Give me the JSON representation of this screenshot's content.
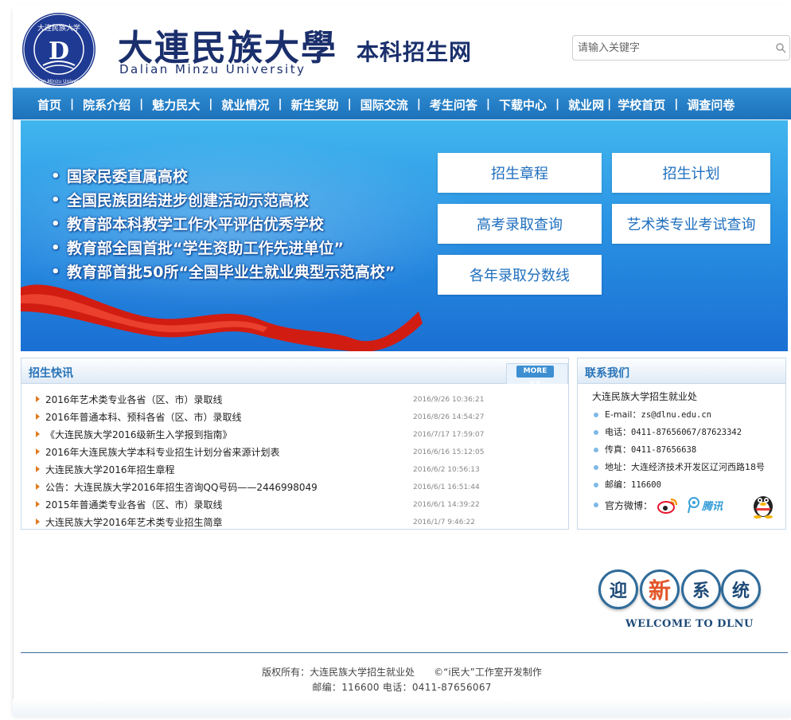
{
  "header": {
    "seal_text": "大连民族大学",
    "seal_text_en": "Dalian Minzu University",
    "university_cn": "大連民族大學",
    "university_en": "Dalian Minzu University",
    "site_title": "本科招生网",
    "search": {
      "placeholder": "请输入关键字",
      "icon": "search-icon"
    }
  },
  "nav": {
    "items": [
      "首页",
      "院系介绍",
      "魅力民大",
      "就业情况",
      "新生奖助",
      "国际交流",
      "考生问答",
      "下载中心",
      "就业网",
      "学校首页",
      "调查问卷"
    ],
    "separator": "|"
  },
  "banner": {
    "bullets": [
      "国家民委直属高校",
      "全国民族团结进步创建活动示范高校",
      "教育部本科教学工作水平评估优秀学校",
      "教育部全国首批“学生资助工作先进单位”",
      "教育部首批50所“全国毕业生就业典型示范高校”"
    ],
    "buttons": [
      "招生章程",
      "招生计划",
      "高考录取查询",
      "艺术类专业考试查询",
      "各年录取分数线"
    ]
  },
  "news": {
    "title": "招生快讯",
    "more": "MORE >>",
    "items": [
      {
        "title": "2016年艺术类专业各省（区、市）录取线",
        "date": "2016/9/26 10:36:21"
      },
      {
        "title": "2016年普通本科、预科各省（区、市）录取线",
        "date": "2016/8/26 14:54:27"
      },
      {
        "title": "《大连民族大学2016级新生入学报到指南》",
        "date": "2016/7/17 17:59:07"
      },
      {
        "title": "2016年大连民族大学本科专业招生计划分省来源计划表",
        "date": "2016/6/16 15:12:05"
      },
      {
        "title": "大连民族大学2016年招生章程",
        "date": "2016/6/2 10:56:13"
      },
      {
        "title": "公告：大连民族大学2016年招生咨询QQ号码——2446998049",
        "date": "2016/6/1 16:51:44"
      },
      {
        "title": "2015年普通类专业各省（区、市）录取线",
        "date": "2016/6/1 14:39:22"
      },
      {
        "title": "大连民族大学2016年艺术类专业招生简章",
        "date": "2016/1/7 9:46:22"
      }
    ]
  },
  "contact": {
    "title": "联系我们",
    "org": "大连民族大学招生就业处",
    "items": [
      {
        "label": "E-mail：",
        "value": "zs@dlnu.edu.cn"
      },
      {
        "label": "电话：",
        "value": "0411-87656067/87623342"
      },
      {
        "label": "传真：",
        "value": "0411-87656638"
      },
      {
        "label": "地址：",
        "value": "大连经济技术开发区辽河西路18号"
      },
      {
        "label": "邮编：",
        "value": "116600"
      }
    ],
    "weibo_label": "官方微博：",
    "tencent_text": "腾讯"
  },
  "welcome": {
    "chars": [
      "迎",
      "新",
      "系",
      "统"
    ],
    "subtitle": "WELCOME TO DLNU"
  },
  "footer": {
    "line1": "版权所有：大连民族大学招生就业处　　©“i民大”工作室开发制作",
    "line2": "邮编：116600 电话：0411-87656067"
  },
  "colors": {
    "nav": "#1d72bb",
    "brand": "#1a2f6c",
    "accent": "#2773b7",
    "highlight": "#e2562a"
  }
}
